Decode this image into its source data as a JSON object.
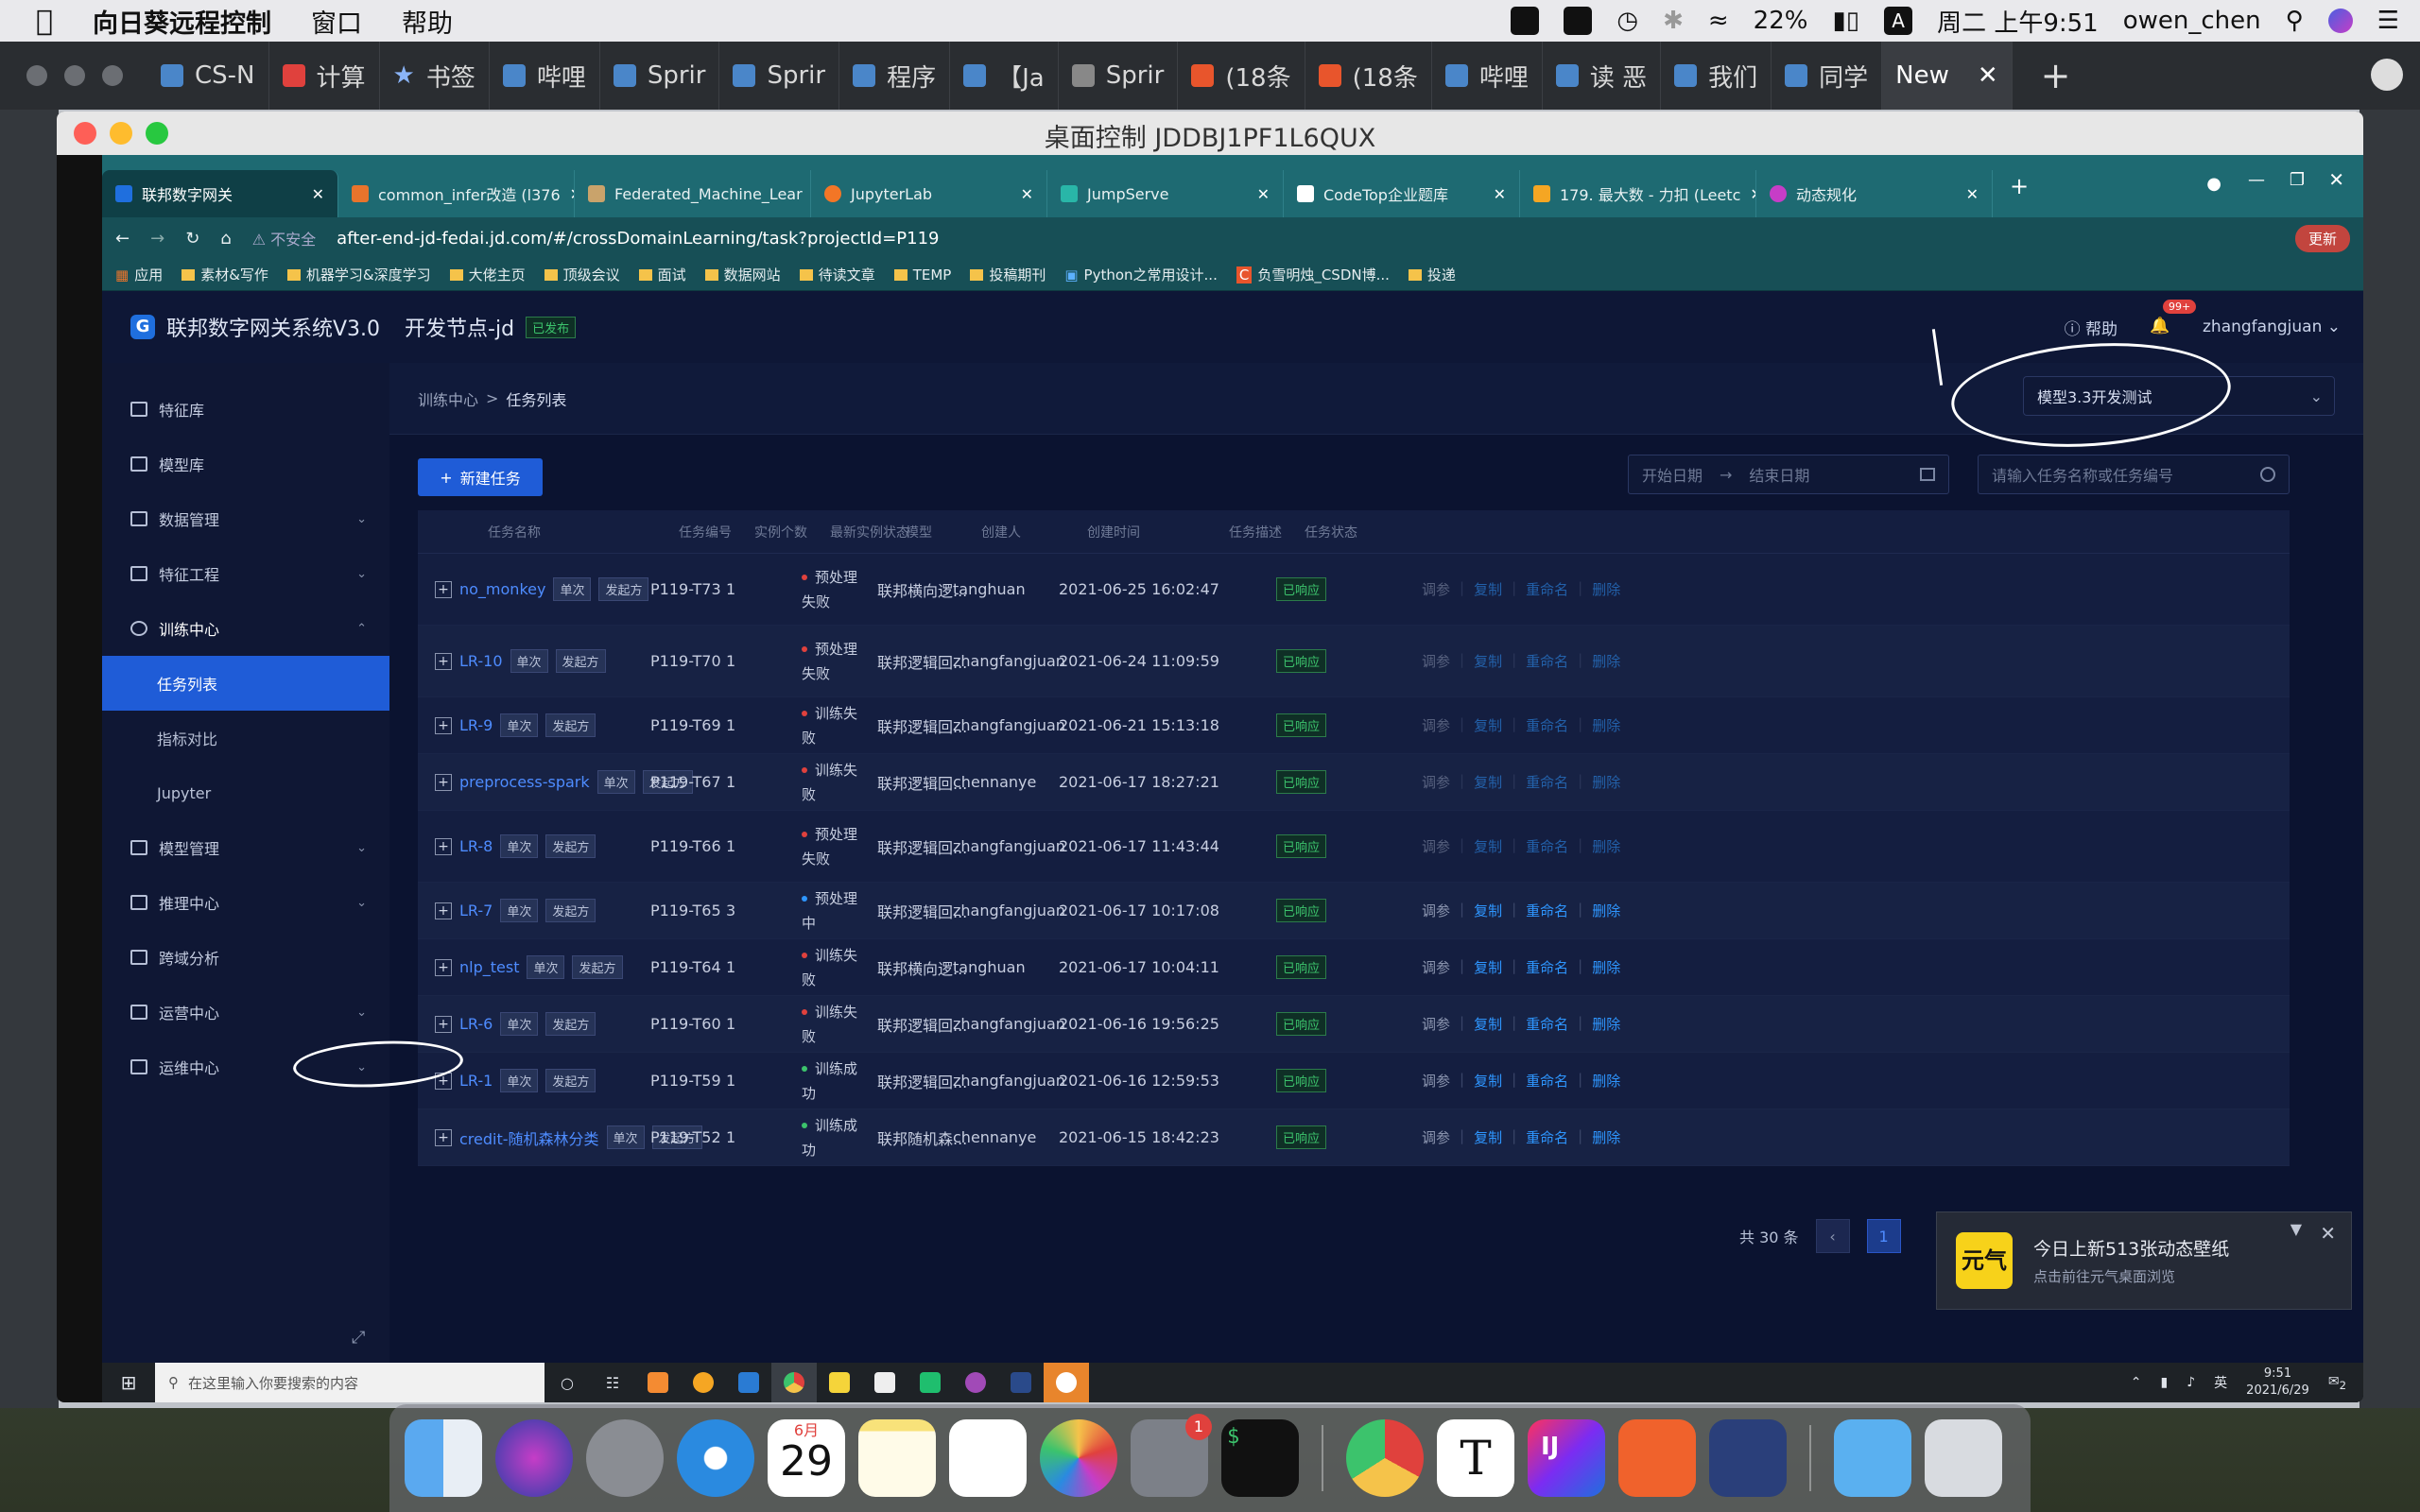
{
  "menubar": {
    "apple": "",
    "app_name": "向日葵远程控制",
    "items": [
      "窗口",
      "帮助"
    ],
    "battery": "22%",
    "input_method": "A",
    "datetime": "周二 上午9:51",
    "user": "owen_chen"
  },
  "outer_tabs": [
    {
      "label": "CS-N"
    },
    {
      "label": "计算"
    },
    {
      "label": "书签"
    },
    {
      "label": "哔哩"
    },
    {
      "label": "Sprir"
    },
    {
      "label": "Sprir"
    },
    {
      "label": "程序"
    },
    {
      "label": "【Ja"
    },
    {
      "label": "Sprir"
    },
    {
      "label": "(18条"
    },
    {
      "label": "(18条"
    },
    {
      "label": "哔哩"
    },
    {
      "label": "读 恶"
    },
    {
      "label": "我们"
    },
    {
      "label": "同学"
    },
    {
      "label": "New"
    }
  ],
  "remote_window": {
    "title": "桌面控制 JDDBJ1PF1L6QUX"
  },
  "inner_browser": {
    "tabs": [
      {
        "label": "联邦数字网关",
        "active": true
      },
      {
        "label": "common_infer改造 (l376"
      },
      {
        "label": "Federated_Machine_Lear"
      },
      {
        "label": "JupyterLab"
      },
      {
        "label": "JumpServe"
      },
      {
        "label": "CodeTop企业题库"
      },
      {
        "label": "179. 最大数 - 力扣 (Leetc"
      },
      {
        "label": "动态规化"
      }
    ],
    "insecure": "不安全",
    "url": "after-end-jd-fedai.jd.com/#/crossDomainLearning/task?projectId=P119",
    "update_btn": "更新",
    "bookmarks": [
      "应用",
      "素材&写作",
      "机器学习&深度学习",
      "大佬主页",
      "顶级会议",
      "面试",
      "数据网站",
      "待读文章",
      "TEMP",
      "投稿期刊",
      "Python之常用设计...",
      "负雪明烛_CSDN博...",
      "投递"
    ]
  },
  "app": {
    "logo_letter": "G",
    "system_name": "联邦数字网关系统V3.0",
    "node_name": "开发节点-jd",
    "node_status": "已发布",
    "help": "帮助",
    "notif_count": "99+",
    "username": "zhangfangjuan",
    "sidebar": [
      {
        "label": "特征库"
      },
      {
        "label": "模型库"
      },
      {
        "label": "数据管理",
        "chev": "⌄"
      },
      {
        "label": "特征工程",
        "chev": "⌄"
      },
      {
        "label": "训练中心",
        "chev": "⌃"
      }
    ],
    "sidebar_sub": [
      "任务列表",
      "指标对比",
      "Jupyter"
    ],
    "sidebar_rest": [
      {
        "label": "模型管理",
        "chev": "⌄"
      },
      {
        "label": "推理中心",
        "chev": "⌄"
      },
      {
        "label": "跨域分析"
      },
      {
        "label": "运营中心",
        "chev": "⌄"
      },
      {
        "label": "运维中心",
        "chev": "⌄"
      }
    ],
    "breadcrumb": {
      "parent": "训练中心",
      "sep": ">",
      "current": "任务列表"
    },
    "project_select": "模型3.3开发测试",
    "new_task": "新建任务",
    "date_start": "开始日期",
    "date_arrow": "→",
    "date_end": "结束日期",
    "search_placeholder": "请输入任务名称或任务编号",
    "table_headers": [
      "任务名称",
      "任务编号",
      "实例个数",
      "最新实例状态",
      "模型",
      "创建人",
      "创建时间",
      "任务描述",
      "任务状态"
    ],
    "rows": [
      {
        "name": "no_monkey",
        "tag1": "单次",
        "tag2": "发起方",
        "id": "P119-T73",
        "count": "1",
        "status": "预处理失败",
        "status_color": "#e0413d",
        "model": "联邦横向逻...",
        "creator": "tanghuan",
        "created": "2021-06-25 16:02:47",
        "task_status": "已响应",
        "bright": false
      },
      {
        "name": "LR-10",
        "tag1": "单次",
        "tag2": "发起方",
        "id": "P119-T70",
        "count": "1",
        "status": "预处理失败",
        "status_color": "#e0413d",
        "model": "联邦逻辑回...",
        "creator": "zhangfangjuan",
        "created": "2021-06-24 11:09:59",
        "task_status": "已响应",
        "bright": false
      },
      {
        "name": "LR-9",
        "tag1": "单次",
        "tag2": "发起方",
        "id": "P119-T69",
        "count": "1",
        "status": "训练失败",
        "status_color": "#e0413d",
        "model": "联邦逻辑回...",
        "creator": "zhangfangjuan",
        "created": "2021-06-21 15:13:18",
        "task_status": "已响应",
        "bright": false
      },
      {
        "name": "preprocess-spark",
        "tag1": "单次",
        "tag2": "发起方",
        "id": "P119-T67",
        "count": "1",
        "status": "训练失败",
        "status_color": "#e0413d",
        "model": "联邦逻辑回...",
        "creator": "chennanye",
        "created": "2021-06-17 18:27:21",
        "task_status": "已响应",
        "bright": false
      },
      {
        "name": "LR-8",
        "tag1": "单次",
        "tag2": "发起方",
        "id": "P119-T66",
        "count": "1",
        "status": "预处理失败",
        "status_color": "#e0413d",
        "model": "联邦逻辑回...",
        "creator": "zhangfangjuan",
        "created": "2021-06-17 11:43:44",
        "task_status": "已响应",
        "bright": false
      },
      {
        "name": "LR-7",
        "tag1": "单次",
        "tag2": "发起方",
        "id": "P119-T65",
        "count": "3",
        "status": "预处理中",
        "status_color": "#2e96ff",
        "model": "联邦逻辑回...",
        "creator": "zhangfangjuan",
        "created": "2021-06-17 10:17:08",
        "task_status": "已响应",
        "bright": true
      },
      {
        "name": "nlp_test",
        "tag1": "单次",
        "tag2": "发起方",
        "id": "P119-T64",
        "count": "1",
        "status": "训练失败",
        "status_color": "#e0413d",
        "model": "联邦横向逻...",
        "creator": "tanghuan",
        "created": "2021-06-17 10:04:11",
        "task_status": "已响应",
        "bright": true
      },
      {
        "name": "LR-6",
        "tag1": "单次",
        "tag2": "发起方",
        "id": "P119-T60",
        "count": "1",
        "status": "训练失败",
        "status_color": "#e0413d",
        "model": "联邦逻辑回...",
        "creator": "zhangfangjuan",
        "created": "2021-06-16 19:56:25",
        "task_status": "已响应",
        "bright": true
      },
      {
        "name": "LR-1",
        "tag1": "单次",
        "tag2": "发起方",
        "id": "P119-T59",
        "count": "1",
        "status": "训练成功",
        "status_color": "#3cc36c",
        "model": "联邦逻辑回...",
        "creator": "zhangfangjuan",
        "created": "2021-06-16 12:59:53",
        "task_status": "已响应",
        "bright": true
      },
      {
        "name": "credit-随机森林分类",
        "tag1": "单次",
        "tag2": "发起方",
        "id": "P119-T52",
        "count": "1",
        "status": "训练成功",
        "status_color": "#3cc36c",
        "model": "联邦随机森...",
        "creator": "chennanye",
        "created": "2021-06-15 18:42:23",
        "task_status": "已响应",
        "bright": true
      }
    ],
    "row_actions": [
      "调参",
      "复制",
      "重命名",
      "删除"
    ],
    "pagination": {
      "total": "共 30 条",
      "page": "1"
    }
  },
  "notification": {
    "logo": "元气",
    "title": "今日上新513张动态壁纸",
    "subtitle": "点击前往元气桌面浏览"
  },
  "win_taskbar": {
    "search_placeholder": "在这里输入你要搜索的内容",
    "ime": "英",
    "time": "9:51",
    "date": "2021/6/29",
    "notif_count": "2"
  },
  "dock": {
    "calendar_month": "6月",
    "calendar_day": "29",
    "sysprefs_badge": "1"
  }
}
